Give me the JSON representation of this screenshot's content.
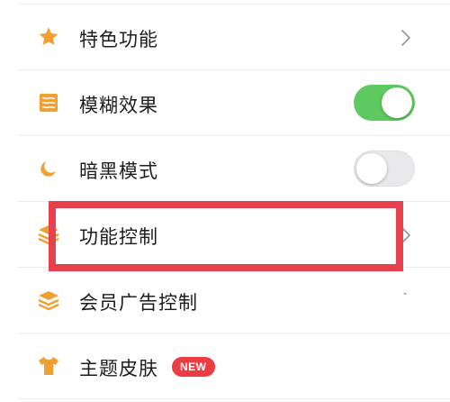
{
  "menu": {
    "items": [
      {
        "label": "特色功能",
        "icon": "star-icon",
        "control": "chevron"
      },
      {
        "label": "模糊效果",
        "icon": "layers-blur-icon",
        "control": "toggle",
        "toggle_on": true
      },
      {
        "label": "暗黑模式",
        "icon": "moon-icon",
        "control": "toggle",
        "toggle_on": false
      },
      {
        "label": "功能控制",
        "icon": "stack-icon",
        "control": "chevron",
        "highlighted": true
      },
      {
        "label": "会员广告控制",
        "icon": "stack-icon",
        "control": "tick",
        "tick_text": "`"
      },
      {
        "label": "主题皮肤",
        "icon": "tshirt-icon",
        "control": "badge",
        "badge_text": "NEW"
      }
    ]
  },
  "colors": {
    "accent_icon": "#f0a030",
    "toggle_on": "#5ec95f",
    "toggle_off": "#e9e9eb",
    "badge": "#ee3c43",
    "highlight": "#e8414e"
  }
}
